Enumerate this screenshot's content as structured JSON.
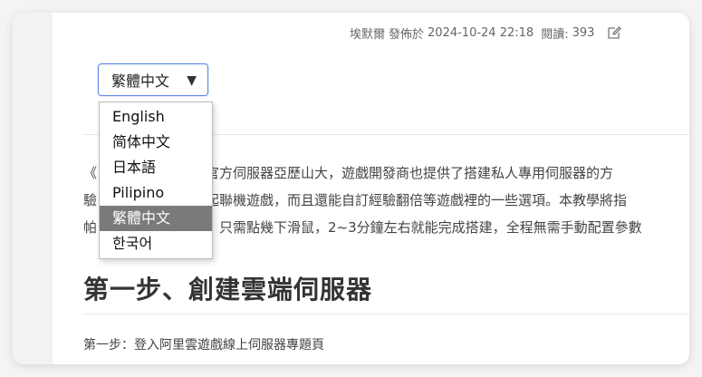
{
  "meta": {
    "author": "埃默爾",
    "published_label": "發佈於",
    "published_at": "2024-10-24 22:18",
    "views_label": "閱讀:",
    "views": "393",
    "edit_icon": "edit-icon"
  },
  "language_select": {
    "selected": "繁體中文",
    "arrow": "▼",
    "options": [
      "English",
      "简体中文",
      "日本語",
      "Pilipino",
      "繁體中文",
      "한국어"
    ],
    "selected_index": 4,
    "accent_color": "#5b86e5"
  },
  "article": {
    "paragraph_lines": [
      "《　　　　　　　，官方伺服器亞歷山大，遊戲開發商也提供了搭建私人專用伺服器的方",
      "驗　　　　　　　一起聯機遊戲，而且還能自訂經驗翻倍等遊戲裡的一些選項。本教學將指",
      "帕　　　　　　　器，只需點幾下滑鼠，2~3分鐘左右就能完成搭建，全程無需手動配置參數"
    ],
    "heading": "第一步、創建雲端伺服器",
    "step_text": "第一步：登入阿里雲遊戲線上伺服器專題頁"
  }
}
